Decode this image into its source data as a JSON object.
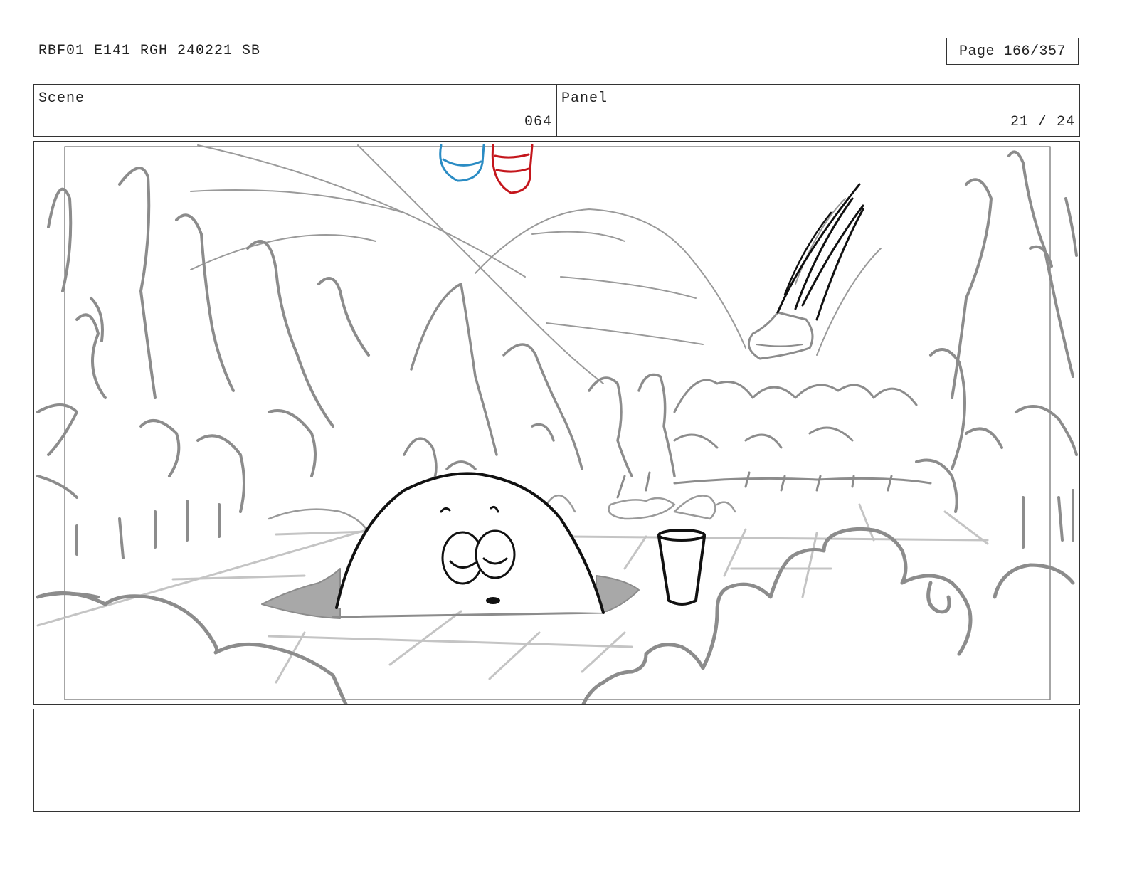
{
  "header": {
    "doc_title": "RBF01 E141 RGH 240221 SB",
    "page_label": "Page 166/357"
  },
  "scene": {
    "label": "Scene",
    "value": "064"
  },
  "panel": {
    "label": "Panel",
    "value": "21 / 24"
  },
  "drawing": {
    "description_icon": "storyboard-sketch",
    "colors": {
      "ink": "#111111",
      "sketch": "#8c8c8c",
      "light": "#bdbdbd",
      "shade": "#a8a8a8",
      "blue": "#2b8cc4",
      "red": "#c4161c"
    }
  },
  "notes": {
    "text": ""
  }
}
